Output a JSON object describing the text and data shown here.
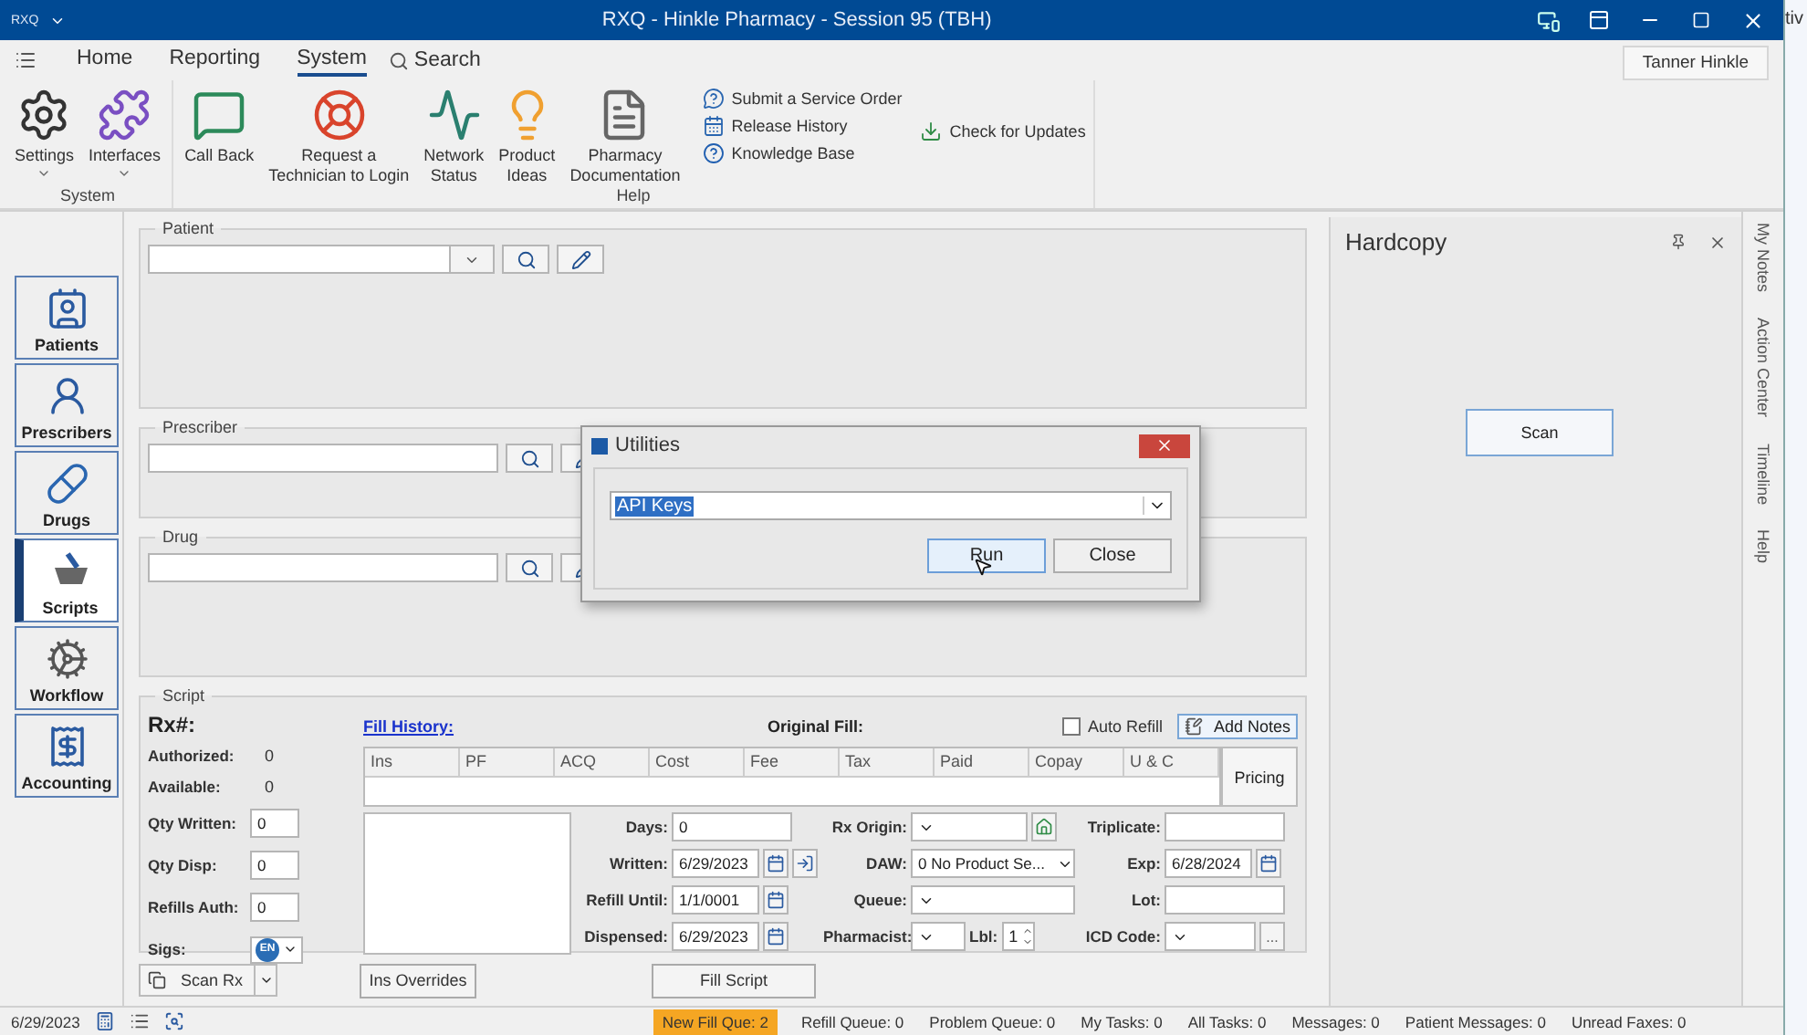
{
  "title_bar": {
    "logo": "RXQ",
    "title": "RXQ - Hinkle Pharmacy - Session 95 (TBH)"
  },
  "ribbon": {
    "tabs": [
      {
        "label": "Home",
        "selected": false
      },
      {
        "label": "Reporting",
        "selected": false
      },
      {
        "label": "System",
        "selected": true
      }
    ],
    "search": "Search",
    "user": "Tanner Hinkle",
    "groups": [
      {
        "label": "System",
        "large": [
          {
            "label": "Settings",
            "kind": "settings",
            "dropdown": true
          },
          {
            "label": "Interfaces",
            "kind": "interfaces",
            "dropdown": true
          }
        ]
      },
      {
        "label": "Help",
        "large": [
          {
            "label": "Call Back",
            "kind": "callback",
            "dropdown": false
          },
          {
            "label": "Request a\nTechnician to Login",
            "kind": "lifebuoy",
            "dropdown": false
          },
          {
            "label": "Network\nStatus",
            "kind": "network",
            "dropdown": false
          },
          {
            "label": "Product\nIdeas",
            "kind": "idea",
            "dropdown": false
          },
          {
            "label": "Pharmacy\nDocumentation",
            "kind": "document",
            "dropdown": false
          }
        ],
        "small_columns": [
          [
            {
              "label": "Submit a Service Order",
              "kind": "service"
            },
            {
              "label": "Release History",
              "kind": "history"
            },
            {
              "label": "Knowledge Base",
              "kind": "knowledge"
            }
          ],
          [
            {
              "label": "Check for Updates",
              "kind": "updates"
            }
          ]
        ]
      }
    ]
  },
  "nav": [
    {
      "label": "Patients",
      "kind": "patients",
      "selected": false
    },
    {
      "label": "Prescribers",
      "kind": "prescribers",
      "selected": false
    },
    {
      "label": "Drugs",
      "kind": "drugs",
      "selected": false
    },
    {
      "label": "Scripts",
      "kind": "scripts",
      "selected": true
    },
    {
      "label": "Workflow",
      "kind": "workflow",
      "selected": false
    },
    {
      "label": "Accounting",
      "kind": "accounting",
      "selected": false
    }
  ],
  "lookups": [
    {
      "legend": "Patient",
      "dropdown": true
    },
    {
      "legend": "Prescriber",
      "dropdown": false
    },
    {
      "legend": "Drug",
      "dropdown": false
    }
  ],
  "script": {
    "legend": "Script",
    "rx_label": "Rx#:",
    "stats": [
      {
        "label": "Authorized:",
        "value": "0"
      },
      {
        "label": "Available:",
        "value": "0"
      }
    ],
    "qty_fields": [
      {
        "label": "Qty Written:",
        "value": "0"
      },
      {
        "label": "Qty Disp:",
        "value": "0"
      },
      {
        "label": "Refills Auth:",
        "value": "0"
      }
    ],
    "sigs": {
      "label": "Sigs:",
      "language": "EN"
    },
    "fill_history": "Fill History:",
    "original_fill": "Original Fill:",
    "auto_refill": {
      "label": "Auto Refill",
      "checked": false
    },
    "add_notes": "Add Notes",
    "columns": [
      "Ins",
      "PF",
      "ACQ",
      "Cost",
      "Fee",
      "Tax",
      "Paid",
      "Copay",
      "U & C"
    ],
    "pricing": "Pricing",
    "form_columns": [
      [
        {
          "label": "Days:",
          "kind": "text",
          "value": "0"
        },
        {
          "label": "Written:",
          "kind": "date",
          "value": "6/29/2023",
          "extra": {
            "kind": "import"
          }
        },
        {
          "label": "Refill Until:",
          "kind": "date",
          "value": "1/1/0001"
        },
        {
          "label": "Dispensed:",
          "kind": "date",
          "value": "6/29/2023"
        }
      ],
      [
        {
          "label": "Rx Origin:",
          "kind": "select",
          "extra": {
            "kind": "home"
          }
        },
        {
          "label": "DAW:",
          "kind": "select",
          "value": "0 No Product Se..."
        },
        {
          "label": "Queue:",
          "kind": "select"
        },
        {
          "label": "Pharmacist:",
          "kind": "select",
          "spinner": {
            "label": "Lbl:",
            "value": "1"
          }
        }
      ],
      [
        {
          "label": "Triplicate:",
          "kind": "text"
        },
        {
          "label": "Exp:",
          "kind": "date",
          "value": "6/28/2024"
        },
        {
          "label": "Lot:",
          "kind": "text"
        },
        {
          "label": "ICD Code:",
          "kind": "select",
          "more": "..."
        }
      ]
    ]
  },
  "actions": {
    "scan_rx": "Scan Rx",
    "ins_overrides": "Ins Overrides",
    "fill_script": "Fill Script"
  },
  "hardcopy": {
    "title": "Hardcopy",
    "scan": "Scan"
  },
  "side_tabs": [
    "My Notes",
    "Action Center",
    "Timeline",
    "Help"
  ],
  "dialog": {
    "title": "Utilities",
    "value": "API Keys",
    "buttons": [
      {
        "label": "Run",
        "focused": true
      },
      {
        "label": "Close",
        "focused": false
      }
    ]
  },
  "status_bar": {
    "date": "6/29/2023",
    "items": [
      {
        "label": "New Fill Que: 2",
        "highlighted": true
      },
      {
        "label": "Refill Queue: 0",
        "highlighted": false
      },
      {
        "label": "Problem Queue: 0",
        "highlighted": false
      },
      {
        "label": "My Tasks: 0",
        "highlighted": false
      },
      {
        "label": "All Tasks: 0",
        "highlighted": false
      },
      {
        "label": "Messages: 0",
        "highlighted": false
      },
      {
        "label": "Patient Messages: 0",
        "highlighted": false
      },
      {
        "label": "Unread Faxes: 0",
        "highlighted": false
      }
    ]
  },
  "desktop": {
    "text": "tiv"
  }
}
